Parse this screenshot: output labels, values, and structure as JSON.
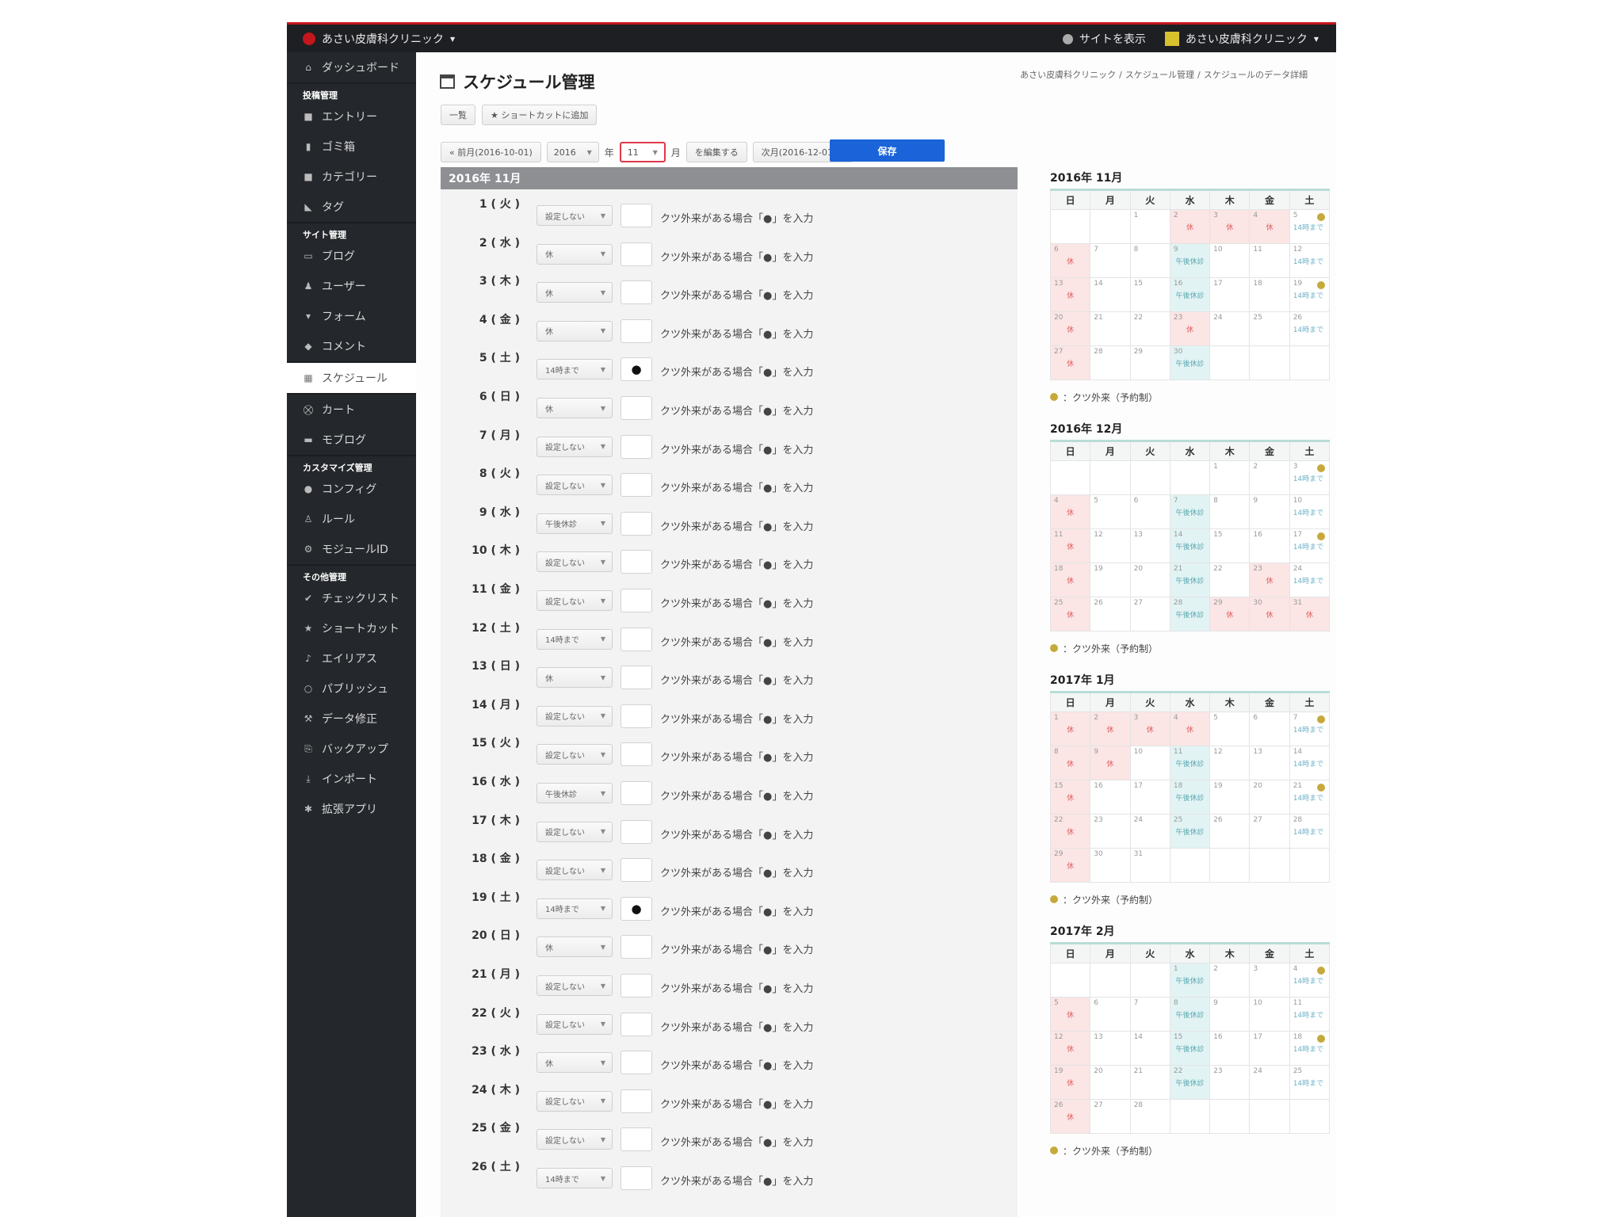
{
  "topbar": {
    "site_name": "あさい皮膚科クリニック",
    "view_site": "サイトを表示",
    "user_name": "あさい皮膚科クリニック"
  },
  "sidebar": {
    "items": [
      {
        "label": "ダッシュボード",
        "icon": "home-icon",
        "glyph": "⌂"
      },
      {
        "label": "エントリー",
        "icon": "document-icon",
        "glyph": "■"
      },
      {
        "label": "ゴミ箱",
        "icon": "trash-icon",
        "glyph": "▮"
      },
      {
        "label": "カテゴリー",
        "icon": "folder-icon",
        "glyph": "■"
      },
      {
        "label": "タグ",
        "icon": "tag-icon",
        "glyph": "◣"
      },
      {
        "label": "ブログ",
        "icon": "blog-icon",
        "glyph": "▭"
      },
      {
        "label": "ユーザー",
        "icon": "user-icon",
        "glyph": "♟"
      },
      {
        "label": "フォーム",
        "icon": "form-icon",
        "glyph": "▾"
      },
      {
        "label": "コメント",
        "icon": "comment-icon",
        "glyph": "◆"
      },
      {
        "label": "スケジュール",
        "icon": "calendar-icon",
        "glyph": "▦"
      },
      {
        "label": "カート",
        "icon": "cart-icon",
        "glyph": "⛒"
      },
      {
        "label": "モブログ",
        "icon": "mail-icon",
        "glyph": "▬"
      },
      {
        "label": "コンフィグ",
        "icon": "gear-icon",
        "glyph": "●"
      },
      {
        "label": "ルール",
        "icon": "rule-icon",
        "glyph": "♙"
      },
      {
        "label": "モジュールID",
        "icon": "module-icon",
        "glyph": "⚙"
      },
      {
        "label": "チェックリスト",
        "icon": "check-icon",
        "glyph": "✔"
      },
      {
        "label": "ショートカット",
        "icon": "star-icon",
        "glyph": "★"
      },
      {
        "label": "エイリアス",
        "icon": "alias-icon",
        "glyph": "♪"
      },
      {
        "label": "パブリッシュ",
        "icon": "publish-icon",
        "glyph": "○"
      },
      {
        "label": "データ修正",
        "icon": "wrench-icon",
        "glyph": "⚒"
      },
      {
        "label": "バックアップ",
        "icon": "backup-icon",
        "glyph": "⎘"
      },
      {
        "label": "インポート",
        "icon": "import-icon",
        "glyph": "⤓"
      },
      {
        "label": "拡張アプリ",
        "icon": "puzzle-icon",
        "glyph": "✱"
      }
    ],
    "groups": [
      "投稿管理",
      "サイト管理",
      "カスタマイズ管理",
      "その他管理"
    ]
  },
  "page": {
    "title": "スケジュール管理",
    "breadcrumb": [
      "あさい皮膚科クリニック",
      "/",
      "スケジュール管理",
      "/",
      "スケジュールのデータ詳細"
    ]
  },
  "toolbar": {
    "list_label": "一覧",
    "shortcut_label": "★ ショートカットに追加"
  },
  "monthnav": {
    "prev_label": "« 前月(2016-10-01)",
    "year_value": "2016",
    "year_suffix": "年",
    "month_value": "11",
    "month_suffix": "月",
    "edit_label": "を編集する",
    "next_label": "次月(2016-12-01) »",
    "save_label": "保存"
  },
  "schedule": {
    "month_header": "2016年 11月",
    "hint": "クツ外来がある場合「●」を入力",
    "rows": [
      {
        "day": "1 ( 火 )",
        "status": "設定しない",
        "mark": ""
      },
      {
        "day": "2 ( 水 )",
        "status": "休",
        "mark": ""
      },
      {
        "day": "3 ( 木 )",
        "status": "休",
        "mark": ""
      },
      {
        "day": "4 ( 金 )",
        "status": "休",
        "mark": ""
      },
      {
        "day": "5 ( 土 )",
        "status": "14時まで",
        "mark": "●"
      },
      {
        "day": "6 ( 日 )",
        "status": "休",
        "mark": ""
      },
      {
        "day": "7 ( 月 )",
        "status": "設定しない",
        "mark": ""
      },
      {
        "day": "8 ( 火 )",
        "status": "設定しない",
        "mark": ""
      },
      {
        "day": "9 ( 水 )",
        "status": "午後休診",
        "mark": ""
      },
      {
        "day": "10 ( 木 )",
        "status": "設定しない",
        "mark": ""
      },
      {
        "day": "11 ( 金 )",
        "status": "設定しない",
        "mark": ""
      },
      {
        "day": "12 ( 土 )",
        "status": "14時まで",
        "mark": ""
      },
      {
        "day": "13 ( 日 )",
        "status": "休",
        "mark": ""
      },
      {
        "day": "14 ( 月 )",
        "status": "設定しない",
        "mark": ""
      },
      {
        "day": "15 ( 火 )",
        "status": "設定しない",
        "mark": ""
      },
      {
        "day": "16 ( 水 )",
        "status": "午後休診",
        "mark": ""
      },
      {
        "day": "17 ( 木 )",
        "status": "設定しない",
        "mark": ""
      },
      {
        "day": "18 ( 金 )",
        "status": "設定しない",
        "mark": ""
      },
      {
        "day": "19 ( 土 )",
        "status": "14時まで",
        "mark": "●"
      },
      {
        "day": "20 ( 日 )",
        "status": "休",
        "mark": ""
      },
      {
        "day": "21 ( 月 )",
        "status": "設定しない",
        "mark": ""
      },
      {
        "day": "22 ( 火 )",
        "status": "設定しない",
        "mark": ""
      },
      {
        "day": "23 ( 水 )",
        "status": "休",
        "mark": ""
      },
      {
        "day": "24 ( 木 )",
        "status": "設定しない",
        "mark": ""
      },
      {
        "day": "25 ( 金 )",
        "status": "設定しない",
        "mark": ""
      },
      {
        "day": "26 ( 土 )",
        "status": "14時まで",
        "mark": ""
      }
    ]
  },
  "calendar_labels": {
    "weekdays": [
      "日",
      "月",
      "火",
      "水",
      "木",
      "金",
      "土"
    ],
    "legend": "：クツ外来（予約制）",
    "hol_mark": "休",
    "pm_mark": "午後休診",
    "short_mark": "14時まで"
  },
  "calendars": [
    {
      "title": "2016年 11月",
      "cells": [
        {
          "d": ""
        },
        {
          "d": ""
        },
        {
          "d": "1"
        },
        {
          "d": "2",
          "k": "hol"
        },
        {
          "d": "3",
          "k": "hol"
        },
        {
          "d": "4",
          "k": "hol"
        },
        {
          "d": "5",
          "k": "short",
          "dot": true
        },
        {
          "d": "6",
          "k": "hol"
        },
        {
          "d": "7"
        },
        {
          "d": "8"
        },
        {
          "d": "9",
          "k": "pm"
        },
        {
          "d": "10"
        },
        {
          "d": "11"
        },
        {
          "d": "12",
          "k": "short"
        },
        {
          "d": "13",
          "k": "hol"
        },
        {
          "d": "14"
        },
        {
          "d": "15"
        },
        {
          "d": "16",
          "k": "pm"
        },
        {
          "d": "17"
        },
        {
          "d": "18"
        },
        {
          "d": "19",
          "k": "short",
          "dot": true
        },
        {
          "d": "20",
          "k": "hol"
        },
        {
          "d": "21"
        },
        {
          "d": "22"
        },
        {
          "d": "23",
          "k": "hol"
        },
        {
          "d": "24"
        },
        {
          "d": "25"
        },
        {
          "d": "26",
          "k": "short"
        },
        {
          "d": "27",
          "k": "hol"
        },
        {
          "d": "28"
        },
        {
          "d": "29"
        },
        {
          "d": "30",
          "k": "pm"
        },
        {
          "d": ""
        },
        {
          "d": ""
        },
        {
          "d": ""
        }
      ]
    },
    {
      "title": "2016年 12月",
      "cells": [
        {
          "d": ""
        },
        {
          "d": ""
        },
        {
          "d": ""
        },
        {
          "d": ""
        },
        {
          "d": "1"
        },
        {
          "d": "2"
        },
        {
          "d": "3",
          "k": "short",
          "dot": true
        },
        {
          "d": "4",
          "k": "hol"
        },
        {
          "d": "5"
        },
        {
          "d": "6"
        },
        {
          "d": "7",
          "k": "pm"
        },
        {
          "d": "8"
        },
        {
          "d": "9"
        },
        {
          "d": "10",
          "k": "short"
        },
        {
          "d": "11",
          "k": "hol"
        },
        {
          "d": "12"
        },
        {
          "d": "13"
        },
        {
          "d": "14",
          "k": "pm"
        },
        {
          "d": "15"
        },
        {
          "d": "16"
        },
        {
          "d": "17",
          "k": "short",
          "dot": true
        },
        {
          "d": "18",
          "k": "hol"
        },
        {
          "d": "19"
        },
        {
          "d": "20"
        },
        {
          "d": "21",
          "k": "pm"
        },
        {
          "d": "22"
        },
        {
          "d": "23",
          "k": "hol"
        },
        {
          "d": "24",
          "k": "short"
        },
        {
          "d": "25",
          "k": "hol"
        },
        {
          "d": "26"
        },
        {
          "d": "27"
        },
        {
          "d": "28",
          "k": "pm"
        },
        {
          "d": "29",
          "k": "hol"
        },
        {
          "d": "30",
          "k": "hol"
        },
        {
          "d": "31",
          "k": "hol"
        }
      ]
    },
    {
      "title": "2017年 1月",
      "cells": [
        {
          "d": "1",
          "k": "hol"
        },
        {
          "d": "2",
          "k": "hol"
        },
        {
          "d": "3",
          "k": "hol"
        },
        {
          "d": "4",
          "k": "hol"
        },
        {
          "d": "5"
        },
        {
          "d": "6"
        },
        {
          "d": "7",
          "k": "short",
          "dot": true
        },
        {
          "d": "8",
          "k": "hol"
        },
        {
          "d": "9",
          "k": "hol"
        },
        {
          "d": "10"
        },
        {
          "d": "11",
          "k": "pm"
        },
        {
          "d": "12"
        },
        {
          "d": "13"
        },
        {
          "d": "14",
          "k": "short"
        },
        {
          "d": "15",
          "k": "hol"
        },
        {
          "d": "16"
        },
        {
          "d": "17"
        },
        {
          "d": "18",
          "k": "pm"
        },
        {
          "d": "19"
        },
        {
          "d": "20"
        },
        {
          "d": "21",
          "k": "short",
          "dot": true
        },
        {
          "d": "22",
          "k": "hol"
        },
        {
          "d": "23"
        },
        {
          "d": "24"
        },
        {
          "d": "25",
          "k": "pm"
        },
        {
          "d": "26"
        },
        {
          "d": "27"
        },
        {
          "d": "28",
          "k": "short"
        },
        {
          "d": "29",
          "k": "hol"
        },
        {
          "d": "30"
        },
        {
          "d": "31"
        },
        {
          "d": ""
        },
        {
          "d": ""
        },
        {
          "d": ""
        },
        {
          "d": ""
        }
      ]
    },
    {
      "title": "2017年 2月",
      "cells": [
        {
          "d": ""
        },
        {
          "d": ""
        },
        {
          "d": ""
        },
        {
          "d": "1",
          "k": "pm"
        },
        {
          "d": "2"
        },
        {
          "d": "3"
        },
        {
          "d": "4",
          "k": "short",
          "dot": true
        },
        {
          "d": "5",
          "k": "hol"
        },
        {
          "d": "6"
        },
        {
          "d": "7"
        },
        {
          "d": "8",
          "k": "pm"
        },
        {
          "d": "9"
        },
        {
          "d": "10"
        },
        {
          "d": "11",
          "k": "short"
        },
        {
          "d": "12",
          "k": "hol"
        },
        {
          "d": "13"
        },
        {
          "d": "14"
        },
        {
          "d": "15",
          "k": "pm"
        },
        {
          "d": "16"
        },
        {
          "d": "17"
        },
        {
          "d": "18",
          "k": "short",
          "dot": true
        },
        {
          "d": "19",
          "k": "hol"
        },
        {
          "d": "20"
        },
        {
          "d": "21"
        },
        {
          "d": "22",
          "k": "pm"
        },
        {
          "d": "23"
        },
        {
          "d": "24"
        },
        {
          "d": "25",
          "k": "short"
        },
        {
          "d": "26",
          "k": "hol"
        },
        {
          "d": "27"
        },
        {
          "d": "28"
        },
        {
          "d": ""
        },
        {
          "d": ""
        },
        {
          "d": ""
        },
        {
          "d": ""
        }
      ]
    }
  ]
}
